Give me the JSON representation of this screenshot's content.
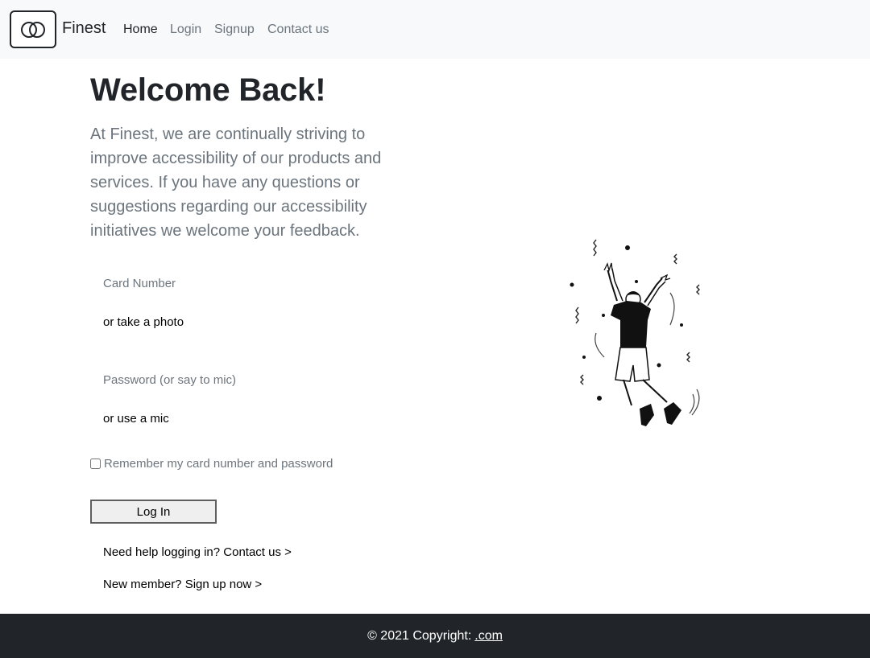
{
  "navbar": {
    "logo_icon": "interlocking-rings-icon",
    "brand": "Finest",
    "links": [
      {
        "label": "Home",
        "active": true
      },
      {
        "label": "Login",
        "active": false
      },
      {
        "label": "Signup",
        "active": false
      },
      {
        "label": "Contact us",
        "active": false
      }
    ]
  },
  "main": {
    "title": "Welcome Back!",
    "intro": "At Finest, we are continually striving to improve accessibility of our products and services. If you have any questions or suggestions regarding our accessibility initiatives we welcome your feedback.",
    "card_number_label": "Card Number",
    "card_number_alt": "or take a photo",
    "password_label": "Password (or say to mic)",
    "password_alt": "or use a mic",
    "remember_label": "Remember my card number and password",
    "remember_checked": false,
    "login_button": "Log In",
    "help_link": "Need help logging in? Contact us >",
    "signup_link": "New member? Sign up now >",
    "illustration_icon": "jumping-person-illustration"
  },
  "footer": {
    "copyright": "© 2021 Copyright:",
    "link": ".com"
  },
  "colors": {
    "navbar_bg": "#f8f9fa",
    "footer_bg": "#212529",
    "muted_text": "#6c757d",
    "dark_text": "#212529"
  }
}
